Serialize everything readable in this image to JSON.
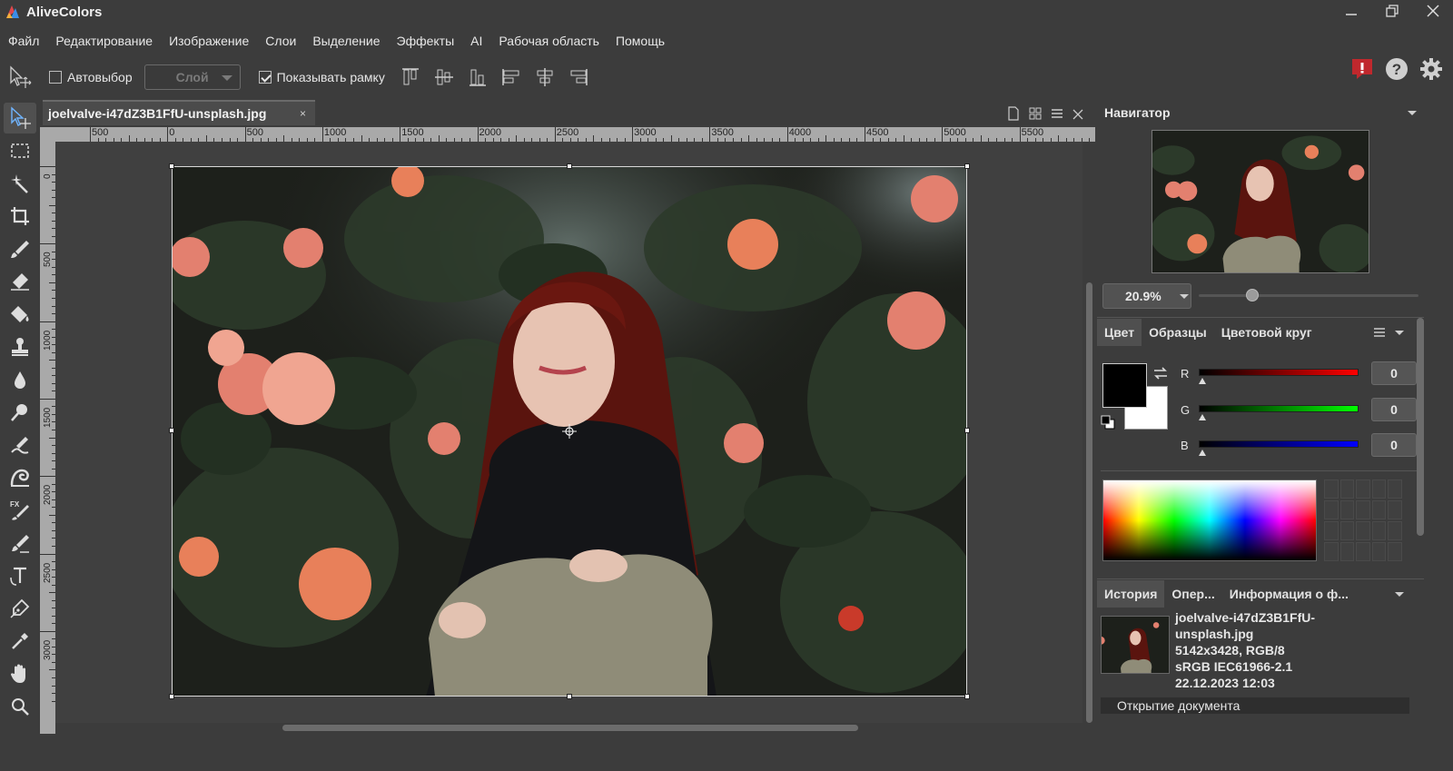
{
  "window": {
    "title": "AliveColors",
    "minimize_icon": "minimize-icon",
    "maximize_icon": "restore-icon",
    "close_icon": "close-icon"
  },
  "menu": {
    "items": [
      "Файл",
      "Редактирование",
      "Изображение",
      "Слои",
      "Выделение",
      "Эффекты",
      "AI",
      "Рабочая область",
      "Помощь"
    ]
  },
  "toolbar": {
    "autoselect_label": "Автовыбор",
    "autoselect_checked": false,
    "layer_select_value": "Слой",
    "show_frame_label": "Показывать рамку",
    "show_frame_checked": true,
    "right_icons": [
      "alert-icon",
      "help-icon",
      "settings-icon"
    ]
  },
  "tools": [
    "move-tool",
    "rect-select-tool",
    "magic-wand-tool",
    "crop-tool",
    "brush-tool",
    "eraser-tool",
    "fill-tool",
    "clone-stamp-tool",
    "blur-tool",
    "dodge-tool",
    "smudge-tool",
    "wave-tool",
    "fx-brush-tool",
    "path-brush-tool",
    "text-tool",
    "pen-tool",
    "eyedropper-tool",
    "hand-tool",
    "zoom-tool"
  ],
  "document": {
    "tab_name": "joelvalve-i47dZ3B1FfU-unsplash.jpg",
    "tab_close": "×",
    "ruler_h_labels": [
      "500",
      "0",
      "500",
      "1000",
      "1500",
      "2000",
      "2500",
      "3000",
      "3500",
      "4000",
      "4500",
      "5000",
      "5500"
    ],
    "ruler_v_labels": [
      "0",
      "500",
      "1000",
      "1500",
      "2000",
      "2500",
      "3000"
    ]
  },
  "navigator": {
    "title": "Навигатор",
    "zoom": "20.9%"
  },
  "color_panel": {
    "tabs": [
      "Цвет",
      "Образцы",
      "Цветовой круг"
    ],
    "active_tab": "Цвет",
    "foreground": "#000000",
    "background": "#ffffff",
    "channels": [
      {
        "label": "R",
        "value": "0",
        "color": "#ff0000"
      },
      {
        "label": "G",
        "value": "0",
        "color": "#00ff00"
      },
      {
        "label": "B",
        "value": "0",
        "color": "#0000ff"
      }
    ]
  },
  "history_panel": {
    "tabs": [
      "История",
      "Опер...",
      "Информация о ф..."
    ],
    "active_tab": "История",
    "file_name_line1": "joelvalve-i47dZ3B1FfU-",
    "file_name_line2": "unsplash.jpg",
    "dimensions": "5142x3428, RGB/8",
    "profile": "sRGB IEC61966-2.1",
    "date": "22.12.2023 12:03",
    "entries": [
      "Открытие документа"
    ]
  }
}
